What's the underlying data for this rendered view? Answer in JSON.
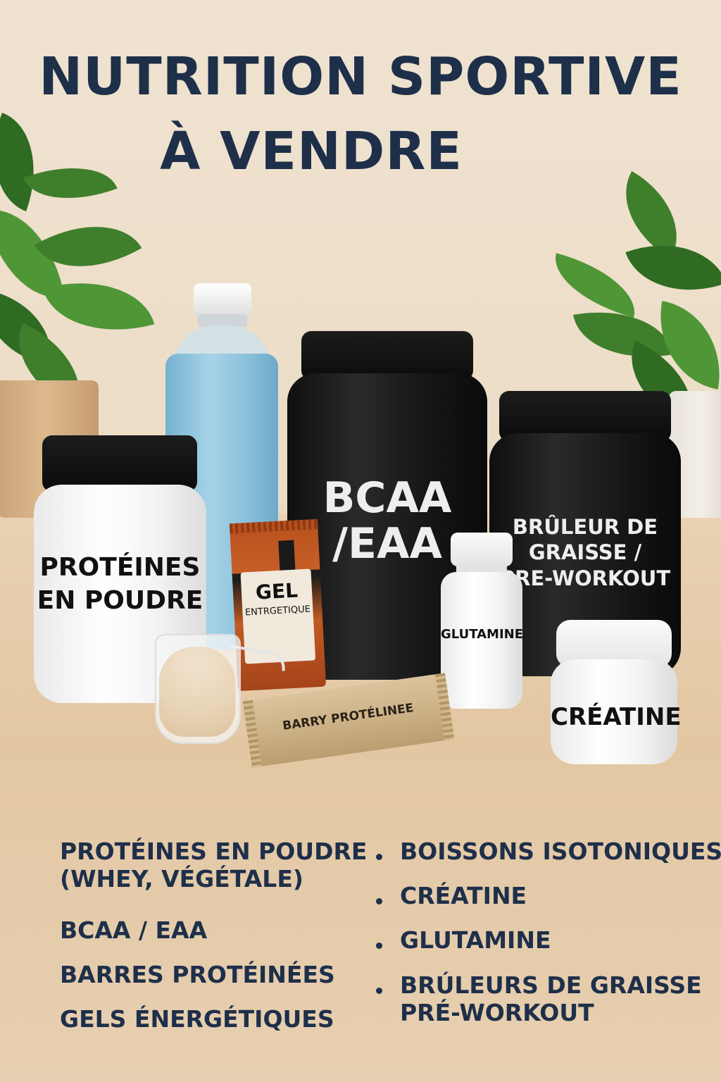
{
  "title": {
    "line1": "NUTRITION SPORTIVE",
    "line2": "À VENDRE"
  },
  "products": {
    "protein_jar": [
      "PROTÉINES",
      "EN POUDRE"
    ],
    "bcaa_jar": [
      "BCAA",
      "/EAA"
    ],
    "burner_jar": [
      "BRÛLEUR DE",
      "GRAISSE /",
      "PRE-WORKOUT"
    ],
    "gel_pack": [
      "GEL",
      "ENTRGETIQUE"
    ],
    "glutamine_bottle": "GLUTAMINE",
    "creatine_jar": "CRÉATINE",
    "protein_bar": "BARRY PROTÉLINEE"
  },
  "list_left": [
    [
      "PROTÉINES EN POUDRE",
      "(WHEY, VÉGÉTALE)"
    ],
    [
      "BCAA / EAA"
    ],
    [
      "BARRES PROTÉINÉES"
    ],
    [
      "GELS ÉNERGÉTIQUES"
    ]
  ],
  "list_right": [
    [
      "BOISSONS ISOTONIQUES"
    ],
    [
      "CRÉATINE"
    ],
    [
      "GLUTAMINE"
    ],
    [
      "BRÚLEURS DE GRAISSE",
      "PRÉ-WORKOUT"
    ]
  ],
  "colors": {
    "heading": "#1e2f4a",
    "background": "#ecdcc6",
    "table": "#e3c7a3",
    "drink": "#8fc3dd",
    "gel_orange": "#b8501e",
    "bar_wrapper": "#cdb388"
  },
  "icons": [
    "plant-left",
    "plant-right",
    "powder-scoop"
  ]
}
